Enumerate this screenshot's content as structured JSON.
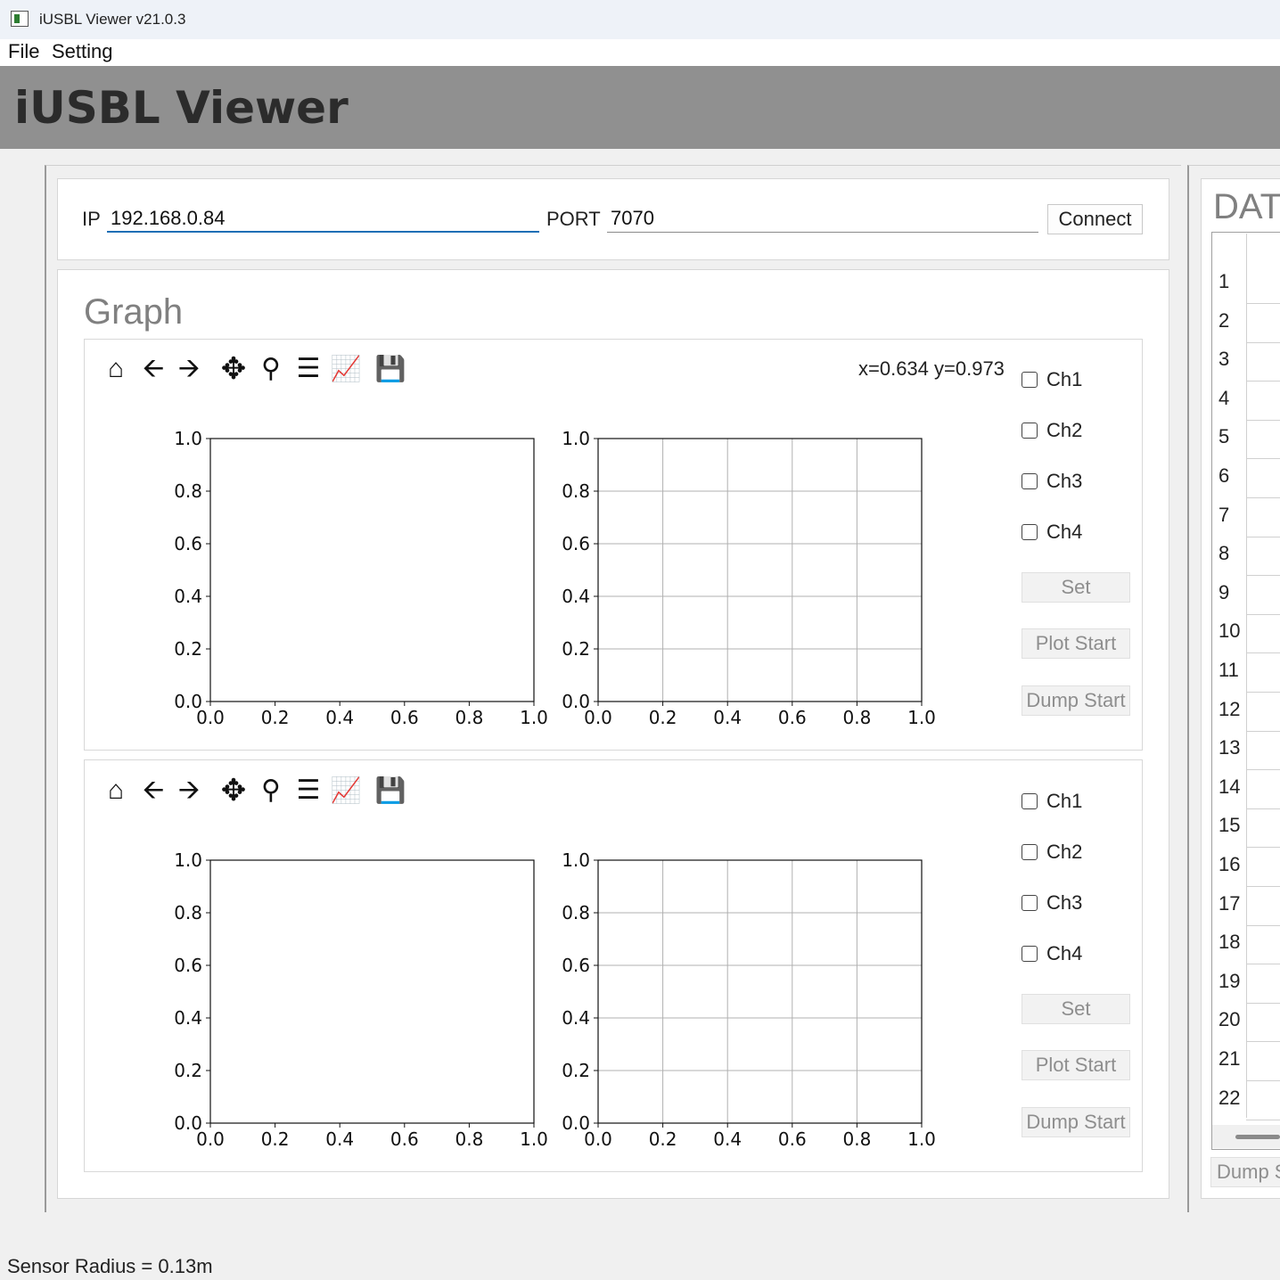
{
  "window": {
    "title": "iUSBL Viewer v21.0.3"
  },
  "menu": {
    "items": [
      "File",
      "Setting"
    ]
  },
  "banner": {
    "title": "iUSBL Viewer"
  },
  "connection": {
    "ip_label": "IP",
    "ip_value": "192.168.0.84",
    "port_label": "PORT",
    "port_value": "7070",
    "connect_label": "Connect"
  },
  "graph": {
    "title": "Graph",
    "coord_readout": "x=0.634 y=0.973",
    "panels": [
      {
        "channels": [
          "Ch1",
          "Ch2",
          "Ch3",
          "Ch4"
        ],
        "set_label": "Set",
        "plot_label": "Plot Start",
        "dump_label": "Dump Start"
      },
      {
        "channels": [
          "Ch1",
          "Ch2",
          "Ch3",
          "Ch4"
        ],
        "set_label": "Set",
        "plot_label": "Plot Start",
        "dump_label": "Dump Start"
      }
    ],
    "toolbar_icons": [
      "home-icon",
      "back-arrow-icon",
      "forward-arrow-icon",
      "pan-icon",
      "zoom-icon",
      "configure-icon",
      "edit-axis-icon",
      "save-icon"
    ]
  },
  "chart_data": [
    {
      "type": "line",
      "series": [],
      "xlim": [
        0.0,
        1.0
      ],
      "ylim": [
        0.0,
        1.0
      ],
      "xticks": [
        "0.0",
        "0.2",
        "0.4",
        "0.6",
        "0.8",
        "1.0"
      ],
      "yticks": [
        "0.0",
        "0.2",
        "0.4",
        "0.6",
        "0.8",
        "1.0"
      ],
      "grid": false
    },
    {
      "type": "line",
      "series": [],
      "xlim": [
        0.0,
        1.0
      ],
      "ylim": [
        0.0,
        1.0
      ],
      "xticks": [
        "0.0",
        "0.2",
        "0.4",
        "0.6",
        "0.8",
        "1.0"
      ],
      "yticks": [
        "0.0",
        "0.2",
        "0.4",
        "0.6",
        "0.8",
        "1.0"
      ],
      "grid": true
    },
    {
      "type": "line",
      "series": [],
      "xlim": [
        0.0,
        1.0
      ],
      "ylim": [
        0.0,
        1.0
      ],
      "xticks": [
        "0.0",
        "0.2",
        "0.4",
        "0.6",
        "0.8",
        "1.0"
      ],
      "yticks": [
        "0.0",
        "0.2",
        "0.4",
        "0.6",
        "0.8",
        "1.0"
      ],
      "grid": false
    },
    {
      "type": "line",
      "series": [],
      "xlim": [
        0.0,
        1.0
      ],
      "ylim": [
        0.0,
        1.0
      ],
      "xticks": [
        "0.0",
        "0.2",
        "0.4",
        "0.6",
        "0.8",
        "1.0"
      ],
      "yticks": [
        "0.0",
        "0.2",
        "0.4",
        "0.6",
        "0.8",
        "1.0"
      ],
      "grid": true
    }
  ],
  "data_panel": {
    "title": "DAT",
    "rows": [
      "1",
      "2",
      "3",
      "4",
      "5",
      "6",
      "7",
      "8",
      "9",
      "10",
      "11",
      "12",
      "13",
      "14",
      "15",
      "16",
      "17",
      "18",
      "19",
      "20",
      "21",
      "22"
    ],
    "dump_label": "Dump S"
  },
  "status": {
    "text": "Sensor Radius = 0.13m"
  }
}
